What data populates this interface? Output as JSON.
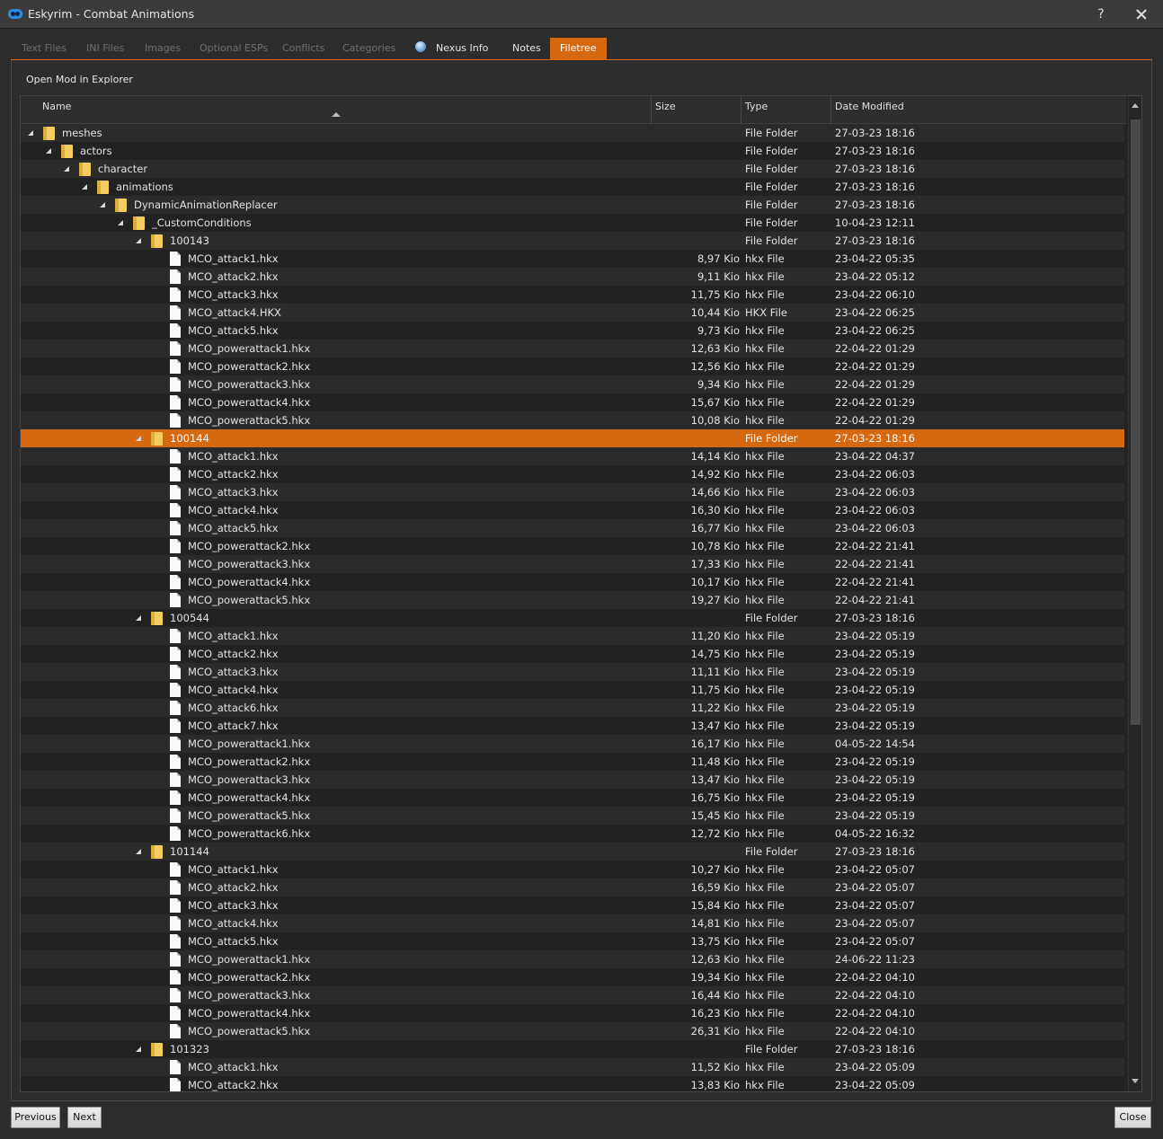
{
  "window": {
    "title": "Eskyrim - Combat Animations",
    "help_label": "?"
  },
  "tabs": [
    {
      "label": "Text Files"
    },
    {
      "label": "INI Files"
    },
    {
      "label": "Images"
    },
    {
      "label": "Optional ESPs"
    },
    {
      "label": "Conflicts"
    },
    {
      "label": "Categories"
    },
    {
      "label": "Nexus Info"
    },
    {
      "label": "Notes"
    },
    {
      "label": "Filetree"
    }
  ],
  "toolbar": {
    "open_explorer_label": "Open Mod in Explorer"
  },
  "filetree": {
    "columns": {
      "name": "Name",
      "size": "Size",
      "type": "Type",
      "date": "Date Modified"
    },
    "rows": [
      {
        "kind": "folder",
        "level": 0,
        "name": "meshes",
        "size": "",
        "type": "File Folder",
        "date": "27-03-23 18:16"
      },
      {
        "kind": "folder",
        "level": 1,
        "name": "actors",
        "size": "",
        "type": "File Folder",
        "date": "27-03-23 18:16"
      },
      {
        "kind": "folder",
        "level": 2,
        "name": "character",
        "size": "",
        "type": "File Folder",
        "date": "27-03-23 18:16"
      },
      {
        "kind": "folder",
        "level": 3,
        "name": "animations",
        "size": "",
        "type": "File Folder",
        "date": "27-03-23 18:16"
      },
      {
        "kind": "folder",
        "level": 4,
        "name": "DynamicAnimationReplacer",
        "size": "",
        "type": "File Folder",
        "date": "27-03-23 18:16"
      },
      {
        "kind": "folder",
        "level": 5,
        "name": "_CustomConditions",
        "size": "",
        "type": "File Folder",
        "date": "10-04-23 12:11"
      },
      {
        "kind": "folder",
        "level": 6,
        "name": "100143",
        "size": "",
        "type": "File Folder",
        "date": "27-03-23 18:16"
      },
      {
        "kind": "file",
        "level": 7,
        "name": "MCO_attack1.hkx",
        "size": "8,97 Kio",
        "type": "hkx File",
        "date": "23-04-22 05:35"
      },
      {
        "kind": "file",
        "level": 7,
        "name": "MCO_attack2.hkx",
        "size": "9,11 Kio",
        "type": "hkx File",
        "date": "23-04-22 05:12"
      },
      {
        "kind": "file",
        "level": 7,
        "name": "MCO_attack3.hkx",
        "size": "11,75 Kio",
        "type": "hkx File",
        "date": "23-04-22 06:10"
      },
      {
        "kind": "file",
        "level": 7,
        "name": "MCO_attack4.HKX",
        "size": "10,44 Kio",
        "type": "HKX File",
        "date": "23-04-22 06:25"
      },
      {
        "kind": "file",
        "level": 7,
        "name": "MCO_attack5.hkx",
        "size": "9,73 Kio",
        "type": "hkx File",
        "date": "23-04-22 06:25"
      },
      {
        "kind": "file",
        "level": 7,
        "name": "MCO_powerattack1.hkx",
        "size": "12,63 Kio",
        "type": "hkx File",
        "date": "22-04-22 01:29"
      },
      {
        "kind": "file",
        "level": 7,
        "name": "MCO_powerattack2.hkx",
        "size": "12,56 Kio",
        "type": "hkx File",
        "date": "22-04-22 01:29"
      },
      {
        "kind": "file",
        "level": 7,
        "name": "MCO_powerattack3.hkx",
        "size": "9,34 Kio",
        "type": "hkx File",
        "date": "22-04-22 01:29"
      },
      {
        "kind": "file",
        "level": 7,
        "name": "MCO_powerattack4.hkx",
        "size": "15,67 Kio",
        "type": "hkx File",
        "date": "22-04-22 01:29"
      },
      {
        "kind": "file",
        "level": 7,
        "name": "MCO_powerattack5.hkx",
        "size": "10,08 Kio",
        "type": "hkx File",
        "date": "22-04-22 01:29"
      },
      {
        "kind": "folder",
        "level": 6,
        "name": "100144",
        "size": "",
        "type": "File Folder",
        "date": "27-03-23 18:16",
        "selected": true
      },
      {
        "kind": "file",
        "level": 7,
        "name": "MCO_attack1.hkx",
        "size": "14,14 Kio",
        "type": "hkx File",
        "date": "23-04-22 04:37"
      },
      {
        "kind": "file",
        "level": 7,
        "name": "MCO_attack2.hkx",
        "size": "14,92 Kio",
        "type": "hkx File",
        "date": "23-04-22 06:03"
      },
      {
        "kind": "file",
        "level": 7,
        "name": "MCO_attack3.hkx",
        "size": "14,66 Kio",
        "type": "hkx File",
        "date": "23-04-22 06:03"
      },
      {
        "kind": "file",
        "level": 7,
        "name": "MCO_attack4.hkx",
        "size": "16,30 Kio",
        "type": "hkx File",
        "date": "23-04-22 06:03"
      },
      {
        "kind": "file",
        "level": 7,
        "name": "MCO_attack5.hkx",
        "size": "16,77 Kio",
        "type": "hkx File",
        "date": "23-04-22 06:03"
      },
      {
        "kind": "file",
        "level": 7,
        "name": "MCO_powerattack2.hkx",
        "size": "10,78 Kio",
        "type": "hkx File",
        "date": "22-04-22 21:41"
      },
      {
        "kind": "file",
        "level": 7,
        "name": "MCO_powerattack3.hkx",
        "size": "17,33 Kio",
        "type": "hkx File",
        "date": "22-04-22 21:41"
      },
      {
        "kind": "file",
        "level": 7,
        "name": "MCO_powerattack4.hkx",
        "size": "10,17 Kio",
        "type": "hkx File",
        "date": "22-04-22 21:41"
      },
      {
        "kind": "file",
        "level": 7,
        "name": "MCO_powerattack5.hkx",
        "size": "19,27 Kio",
        "type": "hkx File",
        "date": "22-04-22 21:41"
      },
      {
        "kind": "folder",
        "level": 6,
        "name": "100544",
        "size": "",
        "type": "File Folder",
        "date": "27-03-23 18:16"
      },
      {
        "kind": "file",
        "level": 7,
        "name": "MCO_attack1.hkx",
        "size": "11,20 Kio",
        "type": "hkx File",
        "date": "23-04-22 05:19"
      },
      {
        "kind": "file",
        "level": 7,
        "name": "MCO_attack2.hkx",
        "size": "14,75 Kio",
        "type": "hkx File",
        "date": "23-04-22 05:19"
      },
      {
        "kind": "file",
        "level": 7,
        "name": "MCO_attack3.hkx",
        "size": "11,11 Kio",
        "type": "hkx File",
        "date": "23-04-22 05:19"
      },
      {
        "kind": "file",
        "level": 7,
        "name": "MCO_attack4.hkx",
        "size": "11,75 Kio",
        "type": "hkx File",
        "date": "23-04-22 05:19"
      },
      {
        "kind": "file",
        "level": 7,
        "name": "MCO_attack6.hkx",
        "size": "11,22 Kio",
        "type": "hkx File",
        "date": "23-04-22 05:19"
      },
      {
        "kind": "file",
        "level": 7,
        "name": "MCO_attack7.hkx",
        "size": "13,47 Kio",
        "type": "hkx File",
        "date": "23-04-22 05:19"
      },
      {
        "kind": "file",
        "level": 7,
        "name": "MCO_powerattack1.hkx",
        "size": "16,17 Kio",
        "type": "hkx File",
        "date": "04-05-22 14:54"
      },
      {
        "kind": "file",
        "level": 7,
        "name": "MCO_powerattack2.hkx",
        "size": "11,48 Kio",
        "type": "hkx File",
        "date": "23-04-22 05:19"
      },
      {
        "kind": "file",
        "level": 7,
        "name": "MCO_powerattack3.hkx",
        "size": "13,47 Kio",
        "type": "hkx File",
        "date": "23-04-22 05:19"
      },
      {
        "kind": "file",
        "level": 7,
        "name": "MCO_powerattack4.hkx",
        "size": "16,75 Kio",
        "type": "hkx File",
        "date": "23-04-22 05:19"
      },
      {
        "kind": "file",
        "level": 7,
        "name": "MCO_powerattack5.hkx",
        "size": "15,45 Kio",
        "type": "hkx File",
        "date": "23-04-22 05:19"
      },
      {
        "kind": "file",
        "level": 7,
        "name": "MCO_powerattack6.hkx",
        "size": "12,72 Kio",
        "type": "hkx File",
        "date": "04-05-22 16:32"
      },
      {
        "kind": "folder",
        "level": 6,
        "name": "101144",
        "size": "",
        "type": "File Folder",
        "date": "27-03-23 18:16"
      },
      {
        "kind": "file",
        "level": 7,
        "name": "MCO_attack1.hkx",
        "size": "10,27 Kio",
        "type": "hkx File",
        "date": "23-04-22 05:07"
      },
      {
        "kind": "file",
        "level": 7,
        "name": "MCO_attack2.hkx",
        "size": "16,59 Kio",
        "type": "hkx File",
        "date": "23-04-22 05:07"
      },
      {
        "kind": "file",
        "level": 7,
        "name": "MCO_attack3.hkx",
        "size": "15,84 Kio",
        "type": "hkx File",
        "date": "23-04-22 05:07"
      },
      {
        "kind": "file",
        "level": 7,
        "name": "MCO_attack4.hkx",
        "size": "14,81 Kio",
        "type": "hkx File",
        "date": "23-04-22 05:07"
      },
      {
        "kind": "file",
        "level": 7,
        "name": "MCO_attack5.hkx",
        "size": "13,75 Kio",
        "type": "hkx File",
        "date": "23-04-22 05:07"
      },
      {
        "kind": "file",
        "level": 7,
        "name": "MCO_powerattack1.hkx",
        "size": "12,63 Kio",
        "type": "hkx File",
        "date": "24-06-22 11:23"
      },
      {
        "kind": "file",
        "level": 7,
        "name": "MCO_powerattack2.hkx",
        "size": "19,34 Kio",
        "type": "hkx File",
        "date": "22-04-22 04:10"
      },
      {
        "kind": "file",
        "level": 7,
        "name": "MCO_powerattack3.hkx",
        "size": "16,44 Kio",
        "type": "hkx File",
        "date": "22-04-22 04:10"
      },
      {
        "kind": "file",
        "level": 7,
        "name": "MCO_powerattack4.hkx",
        "size": "16,23 Kio",
        "type": "hkx File",
        "date": "22-04-22 04:10"
      },
      {
        "kind": "file",
        "level": 7,
        "name": "MCO_powerattack5.hkx",
        "size": "26,31 Kio",
        "type": "hkx File",
        "date": "22-04-22 04:10"
      },
      {
        "kind": "folder",
        "level": 6,
        "name": "101323",
        "size": "",
        "type": "File Folder",
        "date": "27-03-23 18:16"
      },
      {
        "kind": "file",
        "level": 7,
        "name": "MCO_attack1.hkx",
        "size": "11,52 Kio",
        "type": "hkx File",
        "date": "23-04-22 05:09"
      },
      {
        "kind": "file",
        "level": 7,
        "name": "MCO_attack2.hkx",
        "size": "13,83 Kio",
        "type": "hkx File",
        "date": "23-04-22 05:09"
      }
    ]
  },
  "footer": {
    "previous_label": "Previous",
    "next_label": "Next",
    "close_label": "Close"
  }
}
